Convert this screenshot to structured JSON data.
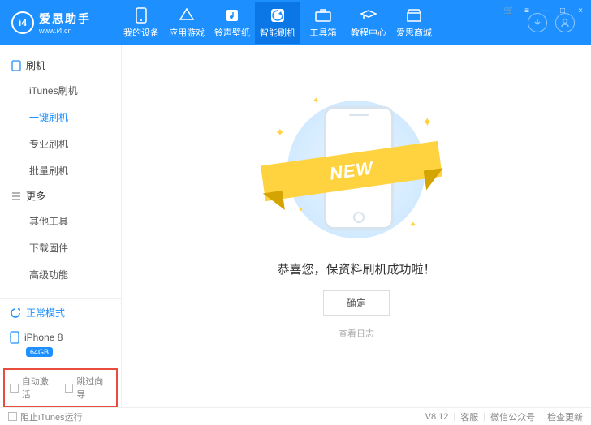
{
  "brand": {
    "name": "爱思助手",
    "site": "www.i4.cn",
    "logo_text": "i4"
  },
  "window_controls": {
    "cart": "🛒",
    "menu": "≡",
    "min": "—",
    "max": "□",
    "close": "×"
  },
  "topnav": [
    {
      "label": "我的设备",
      "icon": "device"
    },
    {
      "label": "应用游戏",
      "icon": "apps"
    },
    {
      "label": "铃声壁纸",
      "icon": "ring"
    },
    {
      "label": "智能刷机",
      "icon": "flash",
      "active": true
    },
    {
      "label": "工具箱",
      "icon": "tool"
    },
    {
      "label": "教程中心",
      "icon": "edu"
    },
    {
      "label": "爱思商城",
      "icon": "store"
    }
  ],
  "sidebar": {
    "groups": [
      {
        "title": "刷机",
        "items": [
          {
            "label": "iTunes刷机"
          },
          {
            "label": "一键刷机",
            "active": true
          },
          {
            "label": "专业刷机"
          },
          {
            "label": "批量刷机"
          }
        ]
      },
      {
        "title": "更多",
        "items": [
          {
            "label": "其他工具"
          },
          {
            "label": "下载固件"
          },
          {
            "label": "高级功能"
          }
        ]
      }
    ],
    "status": "正常模式",
    "device": {
      "name": "iPhone 8",
      "storage": "64GB"
    },
    "checks": {
      "auto_activate": "自动激活",
      "skip_guide": "跳过向导"
    }
  },
  "main": {
    "ribbon": "NEW",
    "message": "恭喜您，保资料刷机成功啦！",
    "ok": "确定",
    "log": "查看日志"
  },
  "footer": {
    "block_itunes": "阻止iTunes运行",
    "version": "V8.12",
    "support": "客服",
    "wechat": "微信公众号",
    "update": "检查更新"
  }
}
